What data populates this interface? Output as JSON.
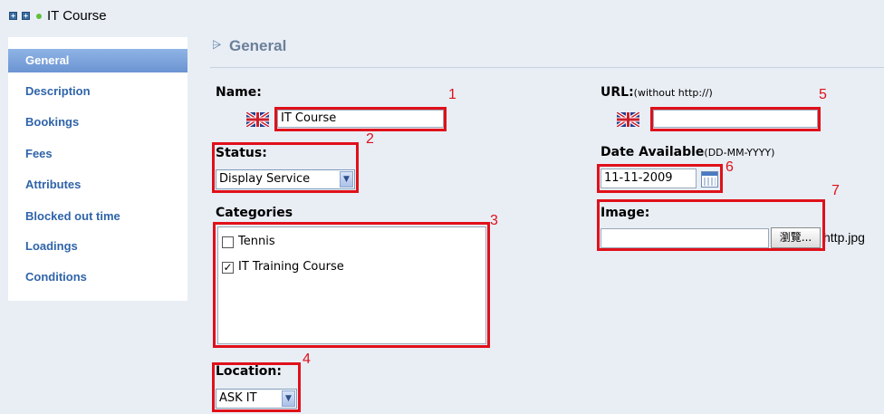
{
  "window": {
    "title": "IT Course",
    "expand_btn_label": "+",
    "collapse_btn_label": "+"
  },
  "sidebar": {
    "items": [
      {
        "label": "General",
        "active": true
      },
      {
        "label": "Description"
      },
      {
        "label": "Bookings"
      },
      {
        "label": "Fees"
      },
      {
        "label": "Attributes"
      },
      {
        "label": "Blocked out time"
      },
      {
        "label": "Loadings"
      },
      {
        "label": "Conditions"
      }
    ]
  },
  "section": {
    "icon": "expand-section-icon",
    "title": "General"
  },
  "form": {
    "name": {
      "label": "Name:",
      "value": "IT Course",
      "flag": "uk-flag-icon"
    },
    "status": {
      "label": "Status:",
      "selected": "Display Service"
    },
    "categories": {
      "label": "Categories",
      "items": [
        {
          "label": "Tennis",
          "checked": false,
          "mark": ""
        },
        {
          "label": "IT Training Course",
          "checked": true,
          "mark": "✓"
        }
      ]
    },
    "location": {
      "label": "Location:",
      "selected": "ASK IT"
    },
    "url": {
      "label": "URL:",
      "hint": "(without http://)",
      "value": "",
      "flag": "uk-flag-icon"
    },
    "date": {
      "label": "Date Available",
      "hint": "(DD-MM-YYYY)",
      "value": "11-11-2009"
    },
    "image": {
      "label": "Image:",
      "browse_label": "瀏覽...",
      "after_text": "http.jpg"
    }
  },
  "annotations": {
    "color": "#e0101a",
    "numbers": [
      "1",
      "2",
      "3",
      "4",
      "5",
      "6",
      "7"
    ]
  }
}
